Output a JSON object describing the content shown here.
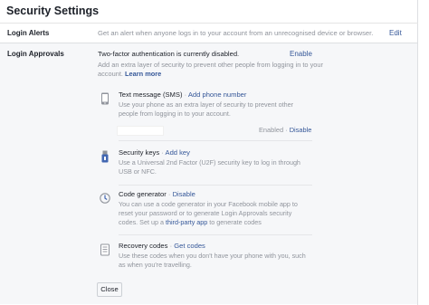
{
  "page": {
    "title": "Security Settings"
  },
  "login_alerts": {
    "label": "Login Alerts",
    "description": "Get an alert when anyone logs in to your account from an unrecognised device or browser.",
    "edit_label": "Edit"
  },
  "login_approvals": {
    "label": "Login Approvals",
    "status": "Two-factor authentication is currently disabled.",
    "enable_label": "Enable",
    "intro": "Add an extra layer of security to prevent other people from logging in to your account.",
    "learn_more": "Learn more",
    "methods": {
      "sms": {
        "title": "Text message (SMS)",
        "action": "Add phone number",
        "description": "Use your phone as an extra layer of security to prevent other people from logging in to your account.",
        "state": "Enabled",
        "disable_label": "Disable",
        "icon": "phone-icon"
      },
      "security_keys": {
        "title": "Security keys",
        "action": "Add key",
        "description": "Use a Universal 2nd Factor (U2F) security key to log in through USB or NFC.",
        "icon": "usb-key-icon"
      },
      "code_generator": {
        "title": "Code generator",
        "action": "Disable",
        "description_pre": "You can use a code generator in your Facebook mobile app to reset your password or to generate Login Approvals security codes. Set up a",
        "description_link": "third-party app",
        "description_post": "to generate codes",
        "icon": "code-generator-icon"
      },
      "recovery_codes": {
        "title": "Recovery codes",
        "action": "Get codes",
        "description": "Use these codes when you don't have your phone with you, such as when you're travelling.",
        "icon": "recovery-codes-icon"
      }
    },
    "close_label": "Close"
  },
  "colors": {
    "link": "#365899",
    "muted": "#90949c",
    "section_bg": "#f6f7f9",
    "icon_blue": "#4267b2"
  }
}
